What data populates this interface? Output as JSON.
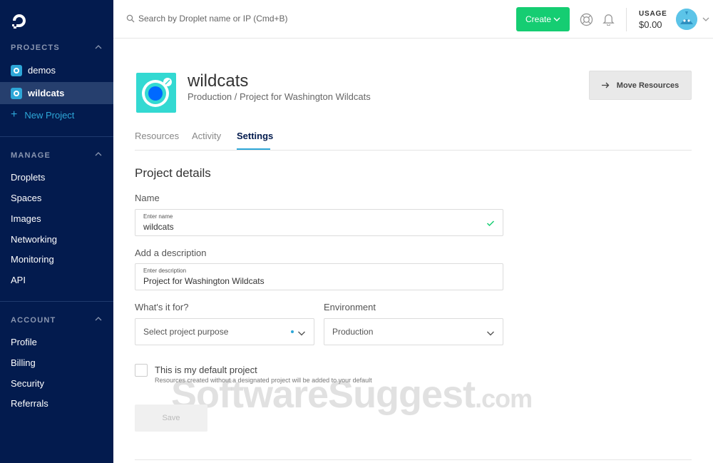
{
  "sidebar": {
    "projects_heading": "PROJECTS",
    "projects": [
      {
        "label": "demos"
      },
      {
        "label": "wildcats"
      }
    ],
    "new_project": "New Project",
    "manage_heading": "MANAGE",
    "manage_items": [
      "Droplets",
      "Spaces",
      "Images",
      "Networking",
      "Monitoring",
      "API"
    ],
    "account_heading": "ACCOUNT",
    "account_items": [
      "Profile",
      "Billing",
      "Security",
      "Referrals"
    ]
  },
  "topbar": {
    "search_placeholder": "Search by Droplet name or IP (Cmd+B)",
    "create_label": "Create",
    "usage_label": "USAGE",
    "usage_value": "$0.00"
  },
  "project": {
    "title": "wildcats",
    "subtitle": "Production / Project for Washington Wildcats",
    "move_label": "Move Resources"
  },
  "tabs": [
    {
      "label": "Resources"
    },
    {
      "label": "Activity"
    },
    {
      "label": "Settings"
    }
  ],
  "form": {
    "heading": "Project details",
    "name_label": "Name",
    "name_mini": "Enter name",
    "name_value": "wildcats",
    "desc_label": "Add a description",
    "desc_mini": "Enter description",
    "desc_value": "Project for Washington Wildcats",
    "purpose_label": "What's it for?",
    "purpose_value": "Select project purpose",
    "env_label": "Environment",
    "env_value": "Production",
    "default_label": "This is my default project",
    "default_help": "Resources created without a designated project will be added to your default",
    "save_label": "Save"
  },
  "watermark": {
    "main": "SoftwareSuggest",
    "suffix": ".com"
  },
  "colors": {
    "sidebar_bg": "#031b4e",
    "accent_blue": "#2ea7d8",
    "create_green": "#15cd72",
    "project_teal": "#33d9d2"
  }
}
